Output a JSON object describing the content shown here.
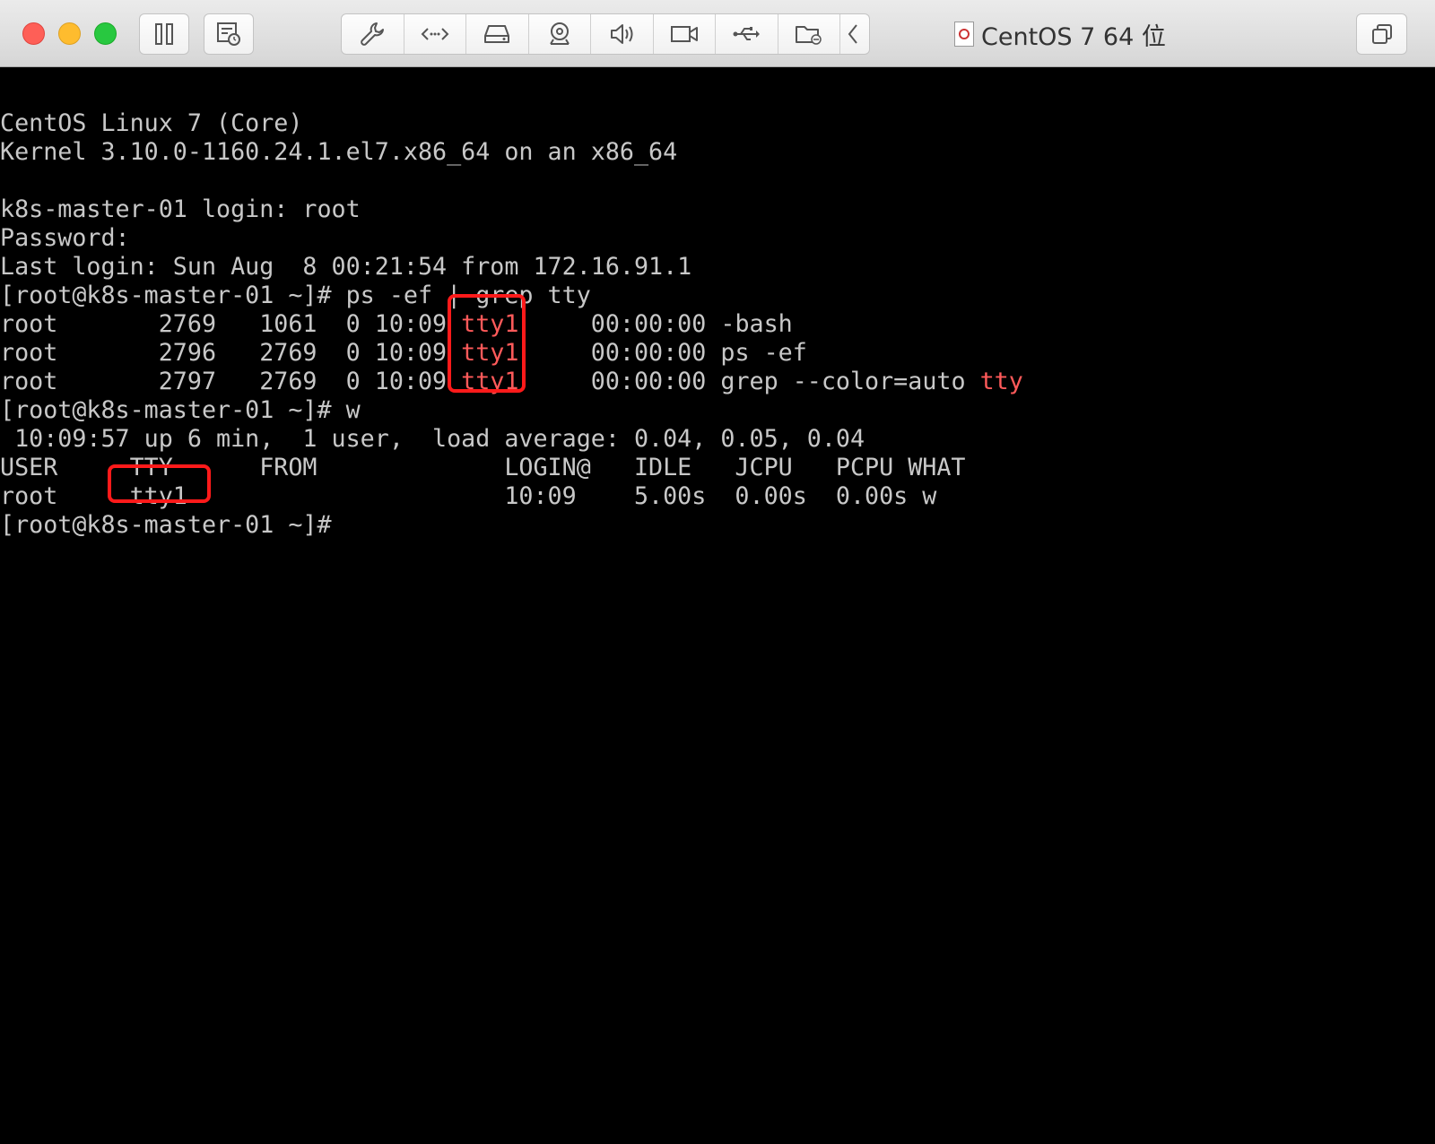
{
  "window": {
    "title": "CentOS 7 64 位",
    "accent_red": "#ff1a1a"
  },
  "toolbar": {
    "left_buttons": [
      "pause-icon",
      "snapshot-icon"
    ],
    "group_buttons": [
      "settings-wrench-icon",
      "network-icon",
      "hard-disk-icon",
      "camera-icon",
      "sound-icon",
      "video-camera-icon",
      "usb-icon",
      "shared-folder-icon",
      "collapse-chevron-icon"
    ],
    "right_button": "fullscreen-icon"
  },
  "terminal": {
    "lines": [
      {
        "segments": [
          {
            "text": ""
          }
        ]
      },
      {
        "segments": [
          {
            "text": "CentOS Linux 7 (Core)"
          }
        ]
      },
      {
        "segments": [
          {
            "text": "Kernel 3.10.0-1160.24.1.el7.x86_64 on an x86_64"
          }
        ]
      },
      {
        "segments": [
          {
            "text": ""
          }
        ]
      },
      {
        "segments": [
          {
            "text": "k8s-master-01 login: root"
          }
        ]
      },
      {
        "segments": [
          {
            "text": "Password:"
          }
        ]
      },
      {
        "segments": [
          {
            "text": "Last login: Sun Aug  8 00:21:54 from 172.16.91.1"
          }
        ]
      },
      {
        "segments": [
          {
            "text": "[root@k8s-master-01 ~]# ps -ef | grep tty"
          }
        ]
      },
      {
        "segments": [
          {
            "text": "root       2769   1061  0 10:09 "
          },
          {
            "text": "tty1",
            "color": "red"
          },
          {
            "text": "     00:00:00 -bash"
          }
        ]
      },
      {
        "segments": [
          {
            "text": "root       2796   2769  0 10:09 "
          },
          {
            "text": "tty1",
            "color": "red"
          },
          {
            "text": "     00:00:00 ps -ef"
          }
        ]
      },
      {
        "segments": [
          {
            "text": "root       2797   2769  0 10:09 "
          },
          {
            "text": "tty1",
            "color": "red"
          },
          {
            "text": "     00:00:00 grep --color=auto "
          },
          {
            "text": "tty",
            "color": "red"
          }
        ]
      },
      {
        "segments": [
          {
            "text": "[root@k8s-master-01 ~]# w"
          }
        ]
      },
      {
        "segments": [
          {
            "text": " 10:09:57 up 6 min,  1 user,  load average: 0.04, 0.05, 0.04"
          }
        ]
      },
      {
        "segments": [
          {
            "text": "USER     TTY      FROM             LOGIN@   IDLE   JCPU   PCPU WHAT"
          }
        ]
      },
      {
        "segments": [
          {
            "text": "root     tty1                      10:09    5.00s  0.00s  0.00s w"
          }
        ]
      },
      {
        "segments": [
          {
            "text": "[root@k8s-master-01 ~]#"
          }
        ]
      }
    ]
  }
}
